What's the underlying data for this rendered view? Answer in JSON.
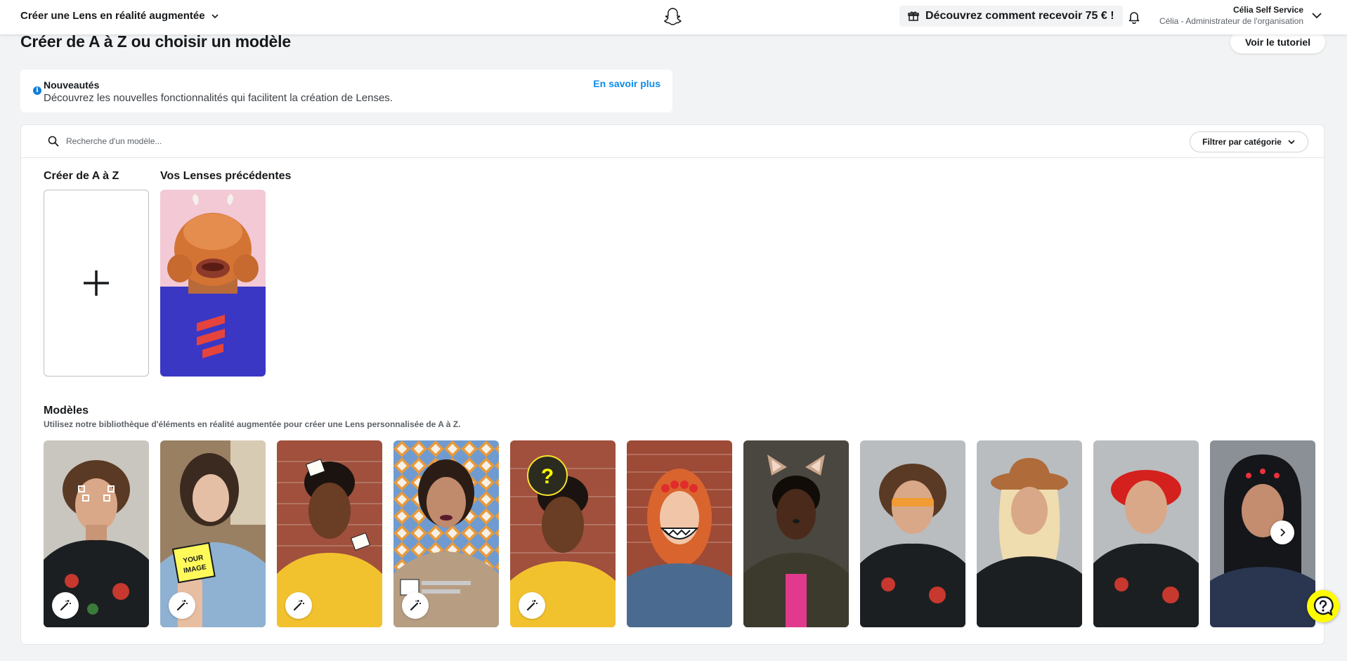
{
  "header": {
    "app_title": "Créer une Lens en réalité augmentée",
    "promo_label": "Découvrez comment recevoir 75 € !",
    "user_name": "Célia Self Service",
    "user_role": "Célia - Administrateur de l'organisation"
  },
  "page": {
    "title": "Créer de A à Z ou choisir un modèle",
    "tutorial_button": "Voir le tutoriel"
  },
  "news": {
    "title": "Nouveautés",
    "text": "Découvrez les nouvelles fonctionnalités qui facilitent la création de Lenses.",
    "link": "En savoir plus"
  },
  "search": {
    "placeholder": "Recherche d'un modèle...",
    "filter_label": "Filtrer par catégorie"
  },
  "sections": {
    "create": "Créer de A à Z",
    "previous": "Vos Lenses précédentes",
    "models_title": "Modèles",
    "models_subtitle": "Utilisez notre bibliothèque d'éléments en réalité augmentée pour créer une Lens personnalisée de A à Z."
  },
  "template_texts": {
    "your_image": "YOUR IMAGE",
    "question_mark": "?"
  },
  "colors": {
    "accent_link": "#0c8ce9",
    "snap_yellow": "#fffc00",
    "info_blue": "#0f7fd9"
  },
  "icons": {
    "app_dropdown": "chevron-down-icon",
    "logo": "snapchat-ghost-icon",
    "promo": "gift-icon",
    "notifications": "bell-icon",
    "search": "search-icon",
    "create": "plus-icon",
    "template_edit": "magic-wand-icon",
    "carousel_next": "chevron-right-icon",
    "help": "help-question-icon"
  }
}
